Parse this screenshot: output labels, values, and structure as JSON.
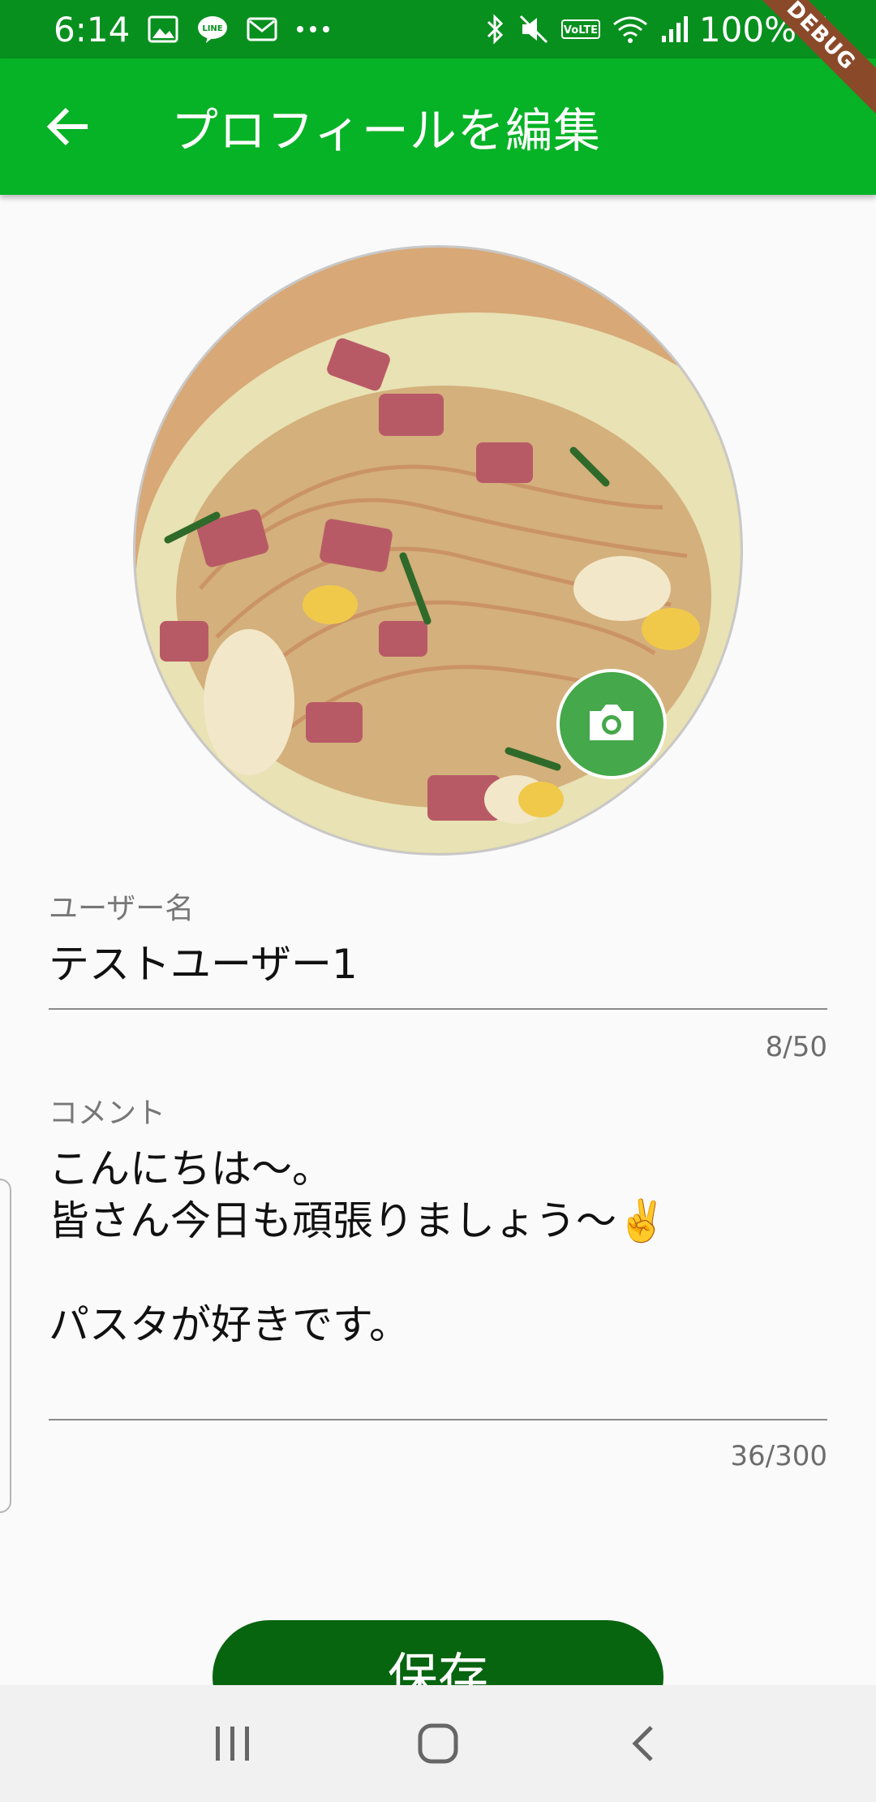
{
  "status_bar": {
    "time": "6:14",
    "battery": "100%",
    "left_icons": [
      "image-icon",
      "line-app-icon",
      "mail-icon",
      "more-dots-icon"
    ],
    "right_icons": [
      "bluetooth-icon",
      "mute-icon",
      "volte-icon",
      "wifi-icon",
      "signal-icon",
      "battery-icon"
    ]
  },
  "debug_ribbon": "DEBUG",
  "app_bar": {
    "title": "プロフィールを編集",
    "back_icon": "arrow-back-icon",
    "color": "#06b226"
  },
  "avatar": {
    "camera_icon": "camera-icon"
  },
  "username_field": {
    "label": "ユーザー名",
    "value": "テストユーザー1",
    "counter": "8/50"
  },
  "comment_field": {
    "label": "コメント",
    "value": "こんにちは〜。\n皆さん今日も頑張りましょう〜✌️\n\nパスタが好きです。",
    "counter": "36/300"
  },
  "save_button": {
    "label": "保存",
    "color": "#07640f"
  },
  "nav_bar": {
    "icons": [
      "recent-apps-icon",
      "home-icon",
      "back-icon"
    ]
  }
}
